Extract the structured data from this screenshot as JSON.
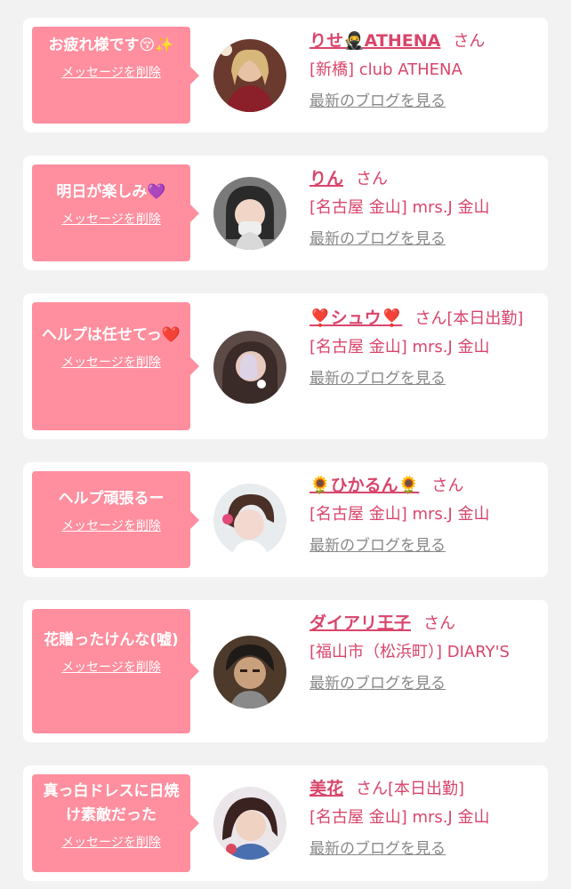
{
  "colors": {
    "background": "#f2f2f2",
    "card": "#ffffff",
    "bubble": "#ff8e9e",
    "accent_text": "#d9456b",
    "muted_link": "#888888"
  },
  "common": {
    "delete_label": "メッセージを削除",
    "blog_label": "最新のブログを見る"
  },
  "items": [
    {
      "message": "お疲れ様です😚✨",
      "name": "りせ🥷ATHENA",
      "suffix": "さん",
      "shop": "[新橋] club ATHENA",
      "avatar_icon": "profile-photo"
    },
    {
      "message": "明日が楽しみ💜",
      "name": "りん",
      "suffix": "さん",
      "shop": "[名古屋 金山] mrs.J 金山",
      "avatar_icon": "profile-photo"
    },
    {
      "message": "ヘルプは任せてっ❤️",
      "name": "❣️シュウ❣️",
      "suffix": "さん[本日出勤]",
      "shop": "[名古屋 金山] mrs.J 金山",
      "avatar_icon": "profile-photo"
    },
    {
      "message": "ヘルプ頑張るー",
      "name": "🌻ひかるん🌻",
      "suffix": "さん",
      "shop": "[名古屋 金山] mrs.J 金山",
      "avatar_icon": "profile-photo"
    },
    {
      "message": "花贈ったけんな(嘘)",
      "name": "ダイアリ王子",
      "suffix": "さん",
      "shop": "[福山市（松浜町）] DIARY'S",
      "avatar_icon": "profile-photo"
    },
    {
      "message": "真っ白ドレスに日焼け素敵だった",
      "name": "美花",
      "suffix": "さん[本日出勤]",
      "shop": "[名古屋 金山] mrs.J 金山",
      "avatar_icon": "profile-photo"
    }
  ]
}
